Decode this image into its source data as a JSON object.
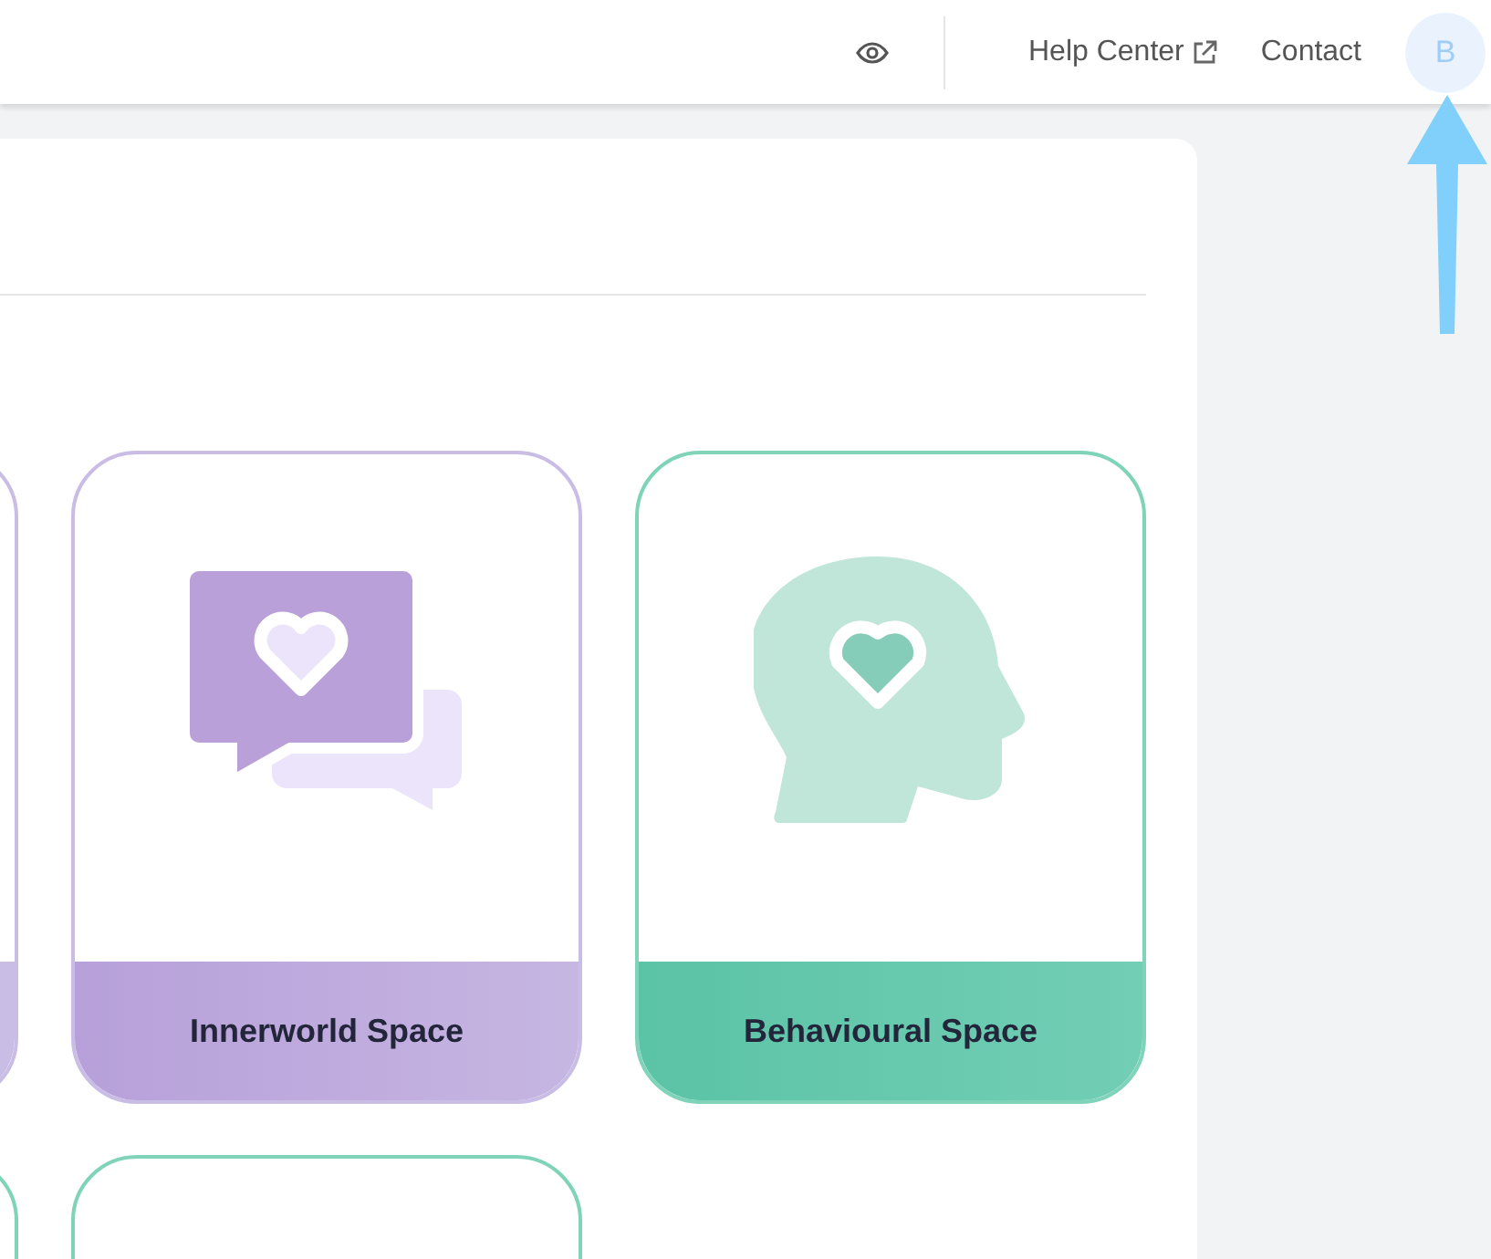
{
  "header": {
    "links": [
      {
        "label": "Help Center",
        "external": true
      },
      {
        "label": "Contact",
        "external": false
      }
    ],
    "avatar": {
      "initial": "B"
    }
  },
  "cards": [
    {
      "kind": "blank",
      "color": "#c9bde6"
    },
    {
      "kind": "chat",
      "color": "#c9bde6",
      "label": "Innerworld Space"
    },
    {
      "kind": "head",
      "color": "#7fd3b8",
      "label": "Behavioural Space"
    },
    {
      "kind": "blank",
      "color": "#7fd3b8"
    },
    {
      "kind": "blank",
      "color": "#7fd3b8"
    }
  ]
}
